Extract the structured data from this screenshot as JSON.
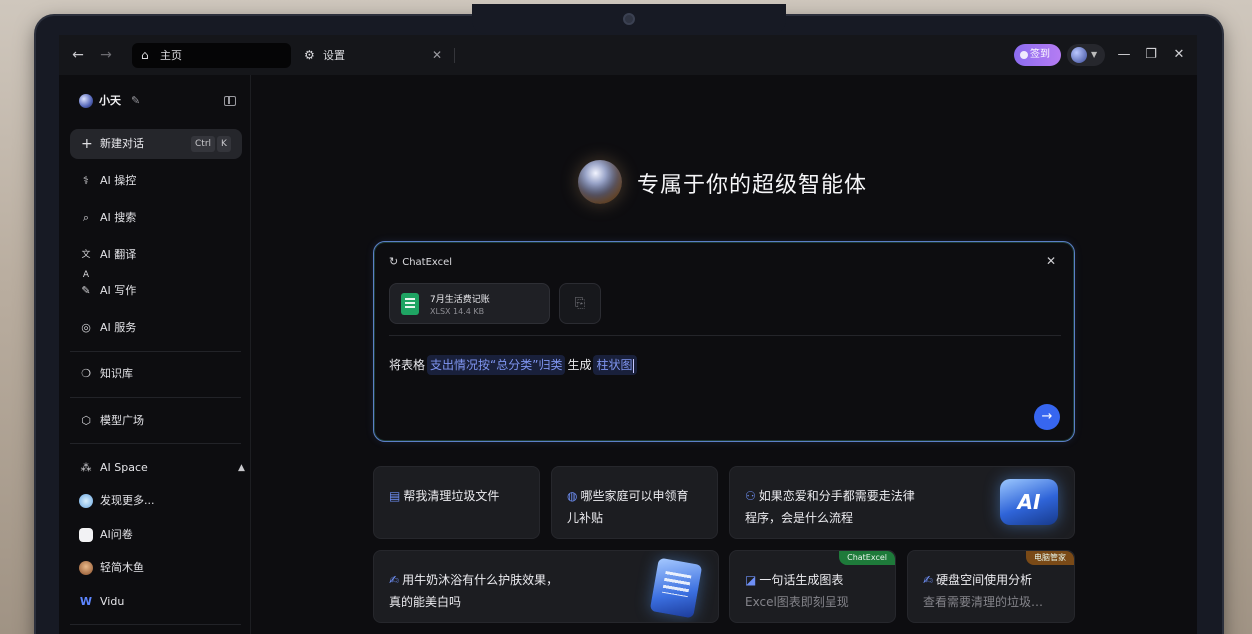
{
  "window": {
    "tabs": [
      {
        "label": "主页",
        "icon": "home-icon",
        "active": true
      },
      {
        "label": "设置",
        "icon": "gear-icon",
        "active": false
      }
    ],
    "signin_label": "签到"
  },
  "sidebar": {
    "user_name": "小天",
    "new_chat": {
      "label": "新建对话",
      "kbd1": "Ctrl",
      "kbd2": "K"
    },
    "items": [
      {
        "label": "AI 操控",
        "icon": "stethoscope-icon"
      },
      {
        "label": "AI 搜索",
        "icon": "search-icon"
      },
      {
        "label": "AI 翻译",
        "icon": "translate-icon"
      },
      {
        "label": "AI 写作",
        "icon": "pen-icon"
      },
      {
        "label": "AI 服务",
        "icon": "service-icon"
      }
    ],
    "knowledge": {
      "label": "知识库"
    },
    "models": {
      "label": "模型广场"
    },
    "ai_space": {
      "label": "AI Space",
      "items": [
        {
          "label": "发现更多..."
        },
        {
          "label": "AI问卷"
        },
        {
          "label": "轻简木鱼"
        },
        {
          "label": "Vidu"
        }
      ]
    }
  },
  "main": {
    "headline": "专属于你的超级智能体",
    "composer": {
      "tag": "ChatExcel",
      "file": {
        "name": "7月生活费记账",
        "meta": "XLSX 14.4 KB"
      },
      "prompt": {
        "p1": "将表格",
        "slot1": "支出情况按“总分类”归类",
        "p2": "生成",
        "slot2": "柱状图"
      }
    },
    "cards": [
      {
        "line1": "帮我清理垃圾文件",
        "line2": ""
      },
      {
        "line1": "哪些家庭可以申领育",
        "line2": "儿补贴"
      },
      {
        "line1": "如果恋爱和分手都需要走法律",
        "line2": "程序，会是什么流程",
        "badge": "AI"
      },
      {
        "line1": "用牛奶沐浴有什么护肤效果，",
        "line2": "真的能美白吗"
      },
      {
        "line1": "一句话生成图表",
        "sub": "Excel图表即刻呈现",
        "ribbon": "ChatExcel"
      },
      {
        "line1": "硬盘空间使用分析",
        "sub": "查看需要清理的垃圾…",
        "ribbon": "电脑管家"
      }
    ]
  },
  "colors": {
    "accent": "#3766f0",
    "slot_text": "#7f95f0",
    "ribbon_chatexcel": "#1e7a3a",
    "ribbon_pcmanager": "#7a4a17"
  }
}
